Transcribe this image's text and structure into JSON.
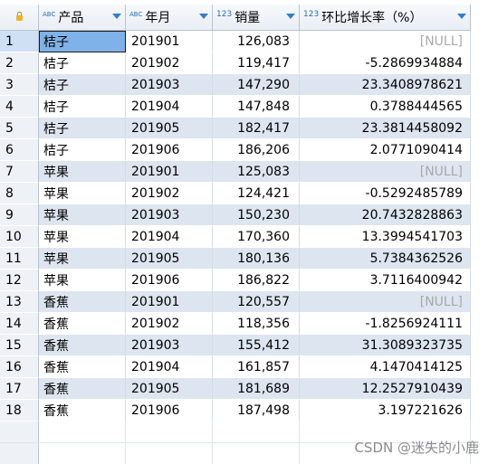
{
  "columns": [
    {
      "type": "ABC",
      "title": "产品"
    },
    {
      "type": "ABC",
      "title": "年月"
    },
    {
      "type": "123",
      "title": "销量"
    },
    {
      "type": "123",
      "title": "环比增长率（%）"
    }
  ],
  "rows": [
    {
      "n": "1",
      "product": "桔子",
      "ym": "201901",
      "sales": "126,083",
      "growth": "[NULL]"
    },
    {
      "n": "2",
      "product": "桔子",
      "ym": "201902",
      "sales": "119,417",
      "growth": "-5.2869934884"
    },
    {
      "n": "3",
      "product": "桔子",
      "ym": "201903",
      "sales": "147,290",
      "growth": "23.3408978621"
    },
    {
      "n": "4",
      "product": "桔子",
      "ym": "201904",
      "sales": "147,848",
      "growth": "0.3788444565"
    },
    {
      "n": "5",
      "product": "桔子",
      "ym": "201905",
      "sales": "182,417",
      "growth": "23.3814458092"
    },
    {
      "n": "6",
      "product": "桔子",
      "ym": "201906",
      "sales": "186,206",
      "growth": "2.0771090414"
    },
    {
      "n": "7",
      "product": "苹果",
      "ym": "201901",
      "sales": "125,083",
      "growth": "[NULL]"
    },
    {
      "n": "8",
      "product": "苹果",
      "ym": "201902",
      "sales": "124,421",
      "growth": "-0.5292485789"
    },
    {
      "n": "9",
      "product": "苹果",
      "ym": "201903",
      "sales": "150,230",
      "growth": "20.7432828863"
    },
    {
      "n": "10",
      "product": "苹果",
      "ym": "201904",
      "sales": "170,360",
      "growth": "13.3994541703"
    },
    {
      "n": "11",
      "product": "苹果",
      "ym": "201905",
      "sales": "180,136",
      "growth": "5.7384362526"
    },
    {
      "n": "12",
      "product": "苹果",
      "ym": "201906",
      "sales": "186,822",
      "growth": "3.7116400942"
    },
    {
      "n": "13",
      "product": "香蕉",
      "ym": "201901",
      "sales": "120,557",
      "growth": "[NULL]"
    },
    {
      "n": "14",
      "product": "香蕉",
      "ym": "201902",
      "sales": "118,356",
      "growth": "-1.8256924111"
    },
    {
      "n": "15",
      "product": "香蕉",
      "ym": "201903",
      "sales": "155,412",
      "growth": "31.3089323735"
    },
    {
      "n": "16",
      "product": "香蕉",
      "ym": "201904",
      "sales": "161,857",
      "growth": "4.1470414125"
    },
    {
      "n": "17",
      "product": "香蕉",
      "ym": "201905",
      "sales": "181,689",
      "growth": "12.2527910439"
    },
    {
      "n": "18",
      "product": "香蕉",
      "ym": "201906",
      "sales": "187,498",
      "growth": "3.197221626"
    }
  ],
  "watermark": "CSDN @迷失的小鹿",
  "colors": {
    "row_alt": "#dde5f0",
    "selected_cell": "#7fb2e8",
    "header": "#e9eef5",
    "type_icon": "#2a6fb0",
    "sort_arrow": "#2f7ed0"
  }
}
